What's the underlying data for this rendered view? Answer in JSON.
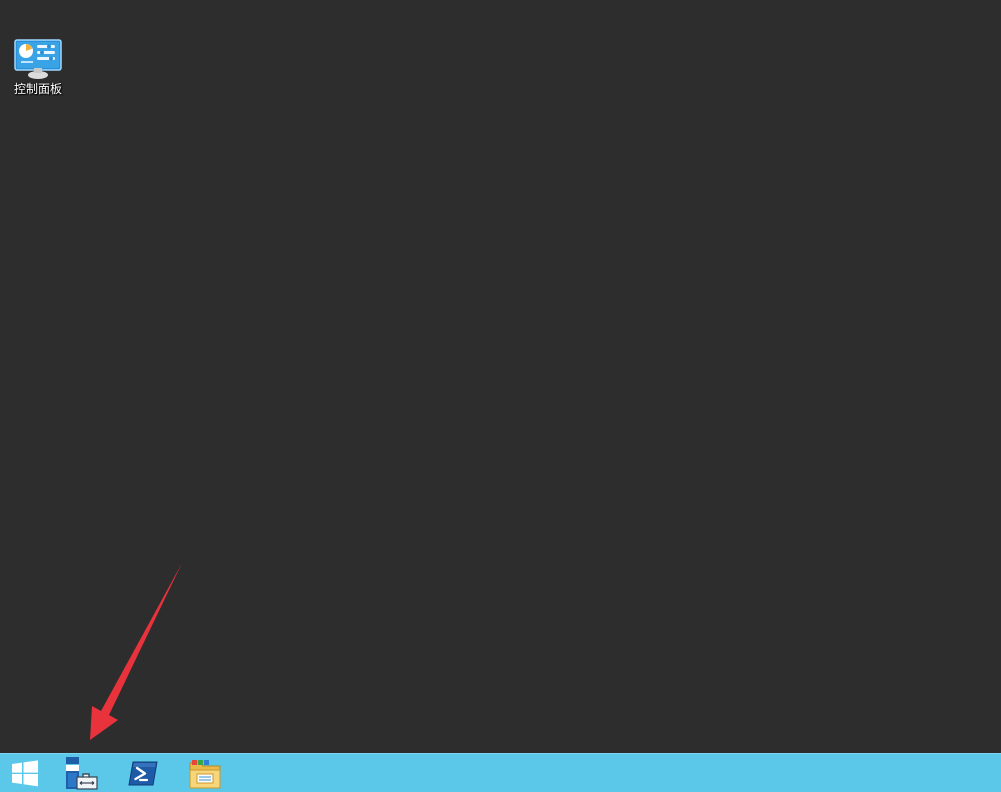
{
  "desktop": {
    "background_color": "#2d2d2d",
    "icons": [
      {
        "label": "控制面板",
        "icon": "control-panel-icon"
      }
    ]
  },
  "taskbar": {
    "background_color": "#5bc8ea",
    "buttons": [
      {
        "icon": "windows-start-icon"
      },
      {
        "icon": "server-manager-icon"
      },
      {
        "icon": "powershell-icon"
      },
      {
        "icon": "file-explorer-icon"
      }
    ]
  },
  "annotation": {
    "type": "arrow",
    "color": "#e8323c",
    "target": "server-manager-button"
  }
}
